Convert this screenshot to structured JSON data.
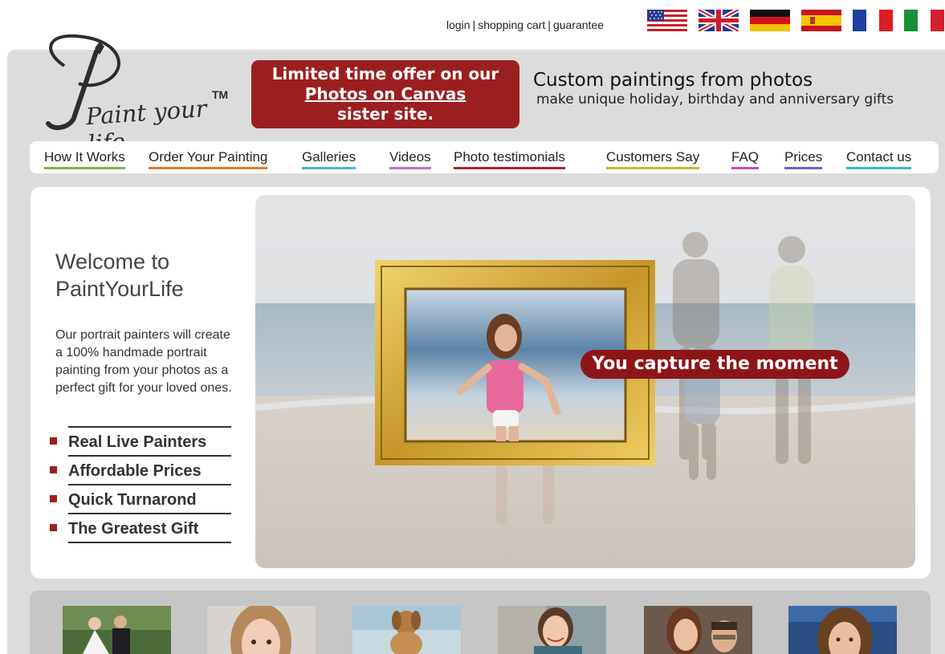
{
  "top_links": [
    "login",
    "shopping cart",
    "guarantee"
  ],
  "top_separator": "|",
  "languages": [
    {
      "name": "English (US)",
      "icon": "us-flag-icon"
    },
    {
      "name": "English (UK)",
      "icon": "uk-flag-icon"
    },
    {
      "name": "German",
      "icon": "germany-flag-icon"
    },
    {
      "name": "Spanish",
      "icon": "spain-flag-icon"
    },
    {
      "name": "French",
      "icon": "france-flag-icon"
    },
    {
      "name": "Italian",
      "icon": "italy-flag-icon"
    }
  ],
  "logo": {
    "text": "Paint your life",
    "mark": "TM",
    "icon": "paintbrush-icon"
  },
  "offer": {
    "line1": "Limited time offer on our",
    "link": "Photos on Canvas",
    "line3": "sister site."
  },
  "tagline": {
    "title": "Custom paintings from photos",
    "subtitle": "make unique holiday, birthday and anniversary gifts"
  },
  "nav": [
    {
      "label": "How It Works",
      "color": "#7ab648"
    },
    {
      "label": "Order Your Painting",
      "color": "#e07b2a"
    },
    {
      "label": "Galleries",
      "color": "#4fb3e0"
    },
    {
      "label": "Videos",
      "color": "#c56bd6"
    },
    {
      "label": "Photo testimonials",
      "color": "#a4282c"
    },
    {
      "label": "Customers Say",
      "color": "#c8b43a"
    },
    {
      "label": "FAQ",
      "color": "#c94fb0"
    },
    {
      "label": "Prices",
      "color": "#7c5cc4"
    },
    {
      "label": "Contact us",
      "color": "#3cb6c9"
    }
  ],
  "welcome": {
    "line1": "Welcome to",
    "line2": "PaintYourLife"
  },
  "intro": "Our portrait painters will create a 100% handmade portrait painting from your photos as a perfect gift for your loved ones.",
  "features": [
    "Real Live Painters",
    "Affordable Prices",
    "Quick Turnarond",
    "The Greatest Gift"
  ],
  "hero": {
    "caption": "You capture the moment"
  },
  "colors": {
    "accent": "#9c1f1f",
    "panel": "#dcdcdc"
  }
}
